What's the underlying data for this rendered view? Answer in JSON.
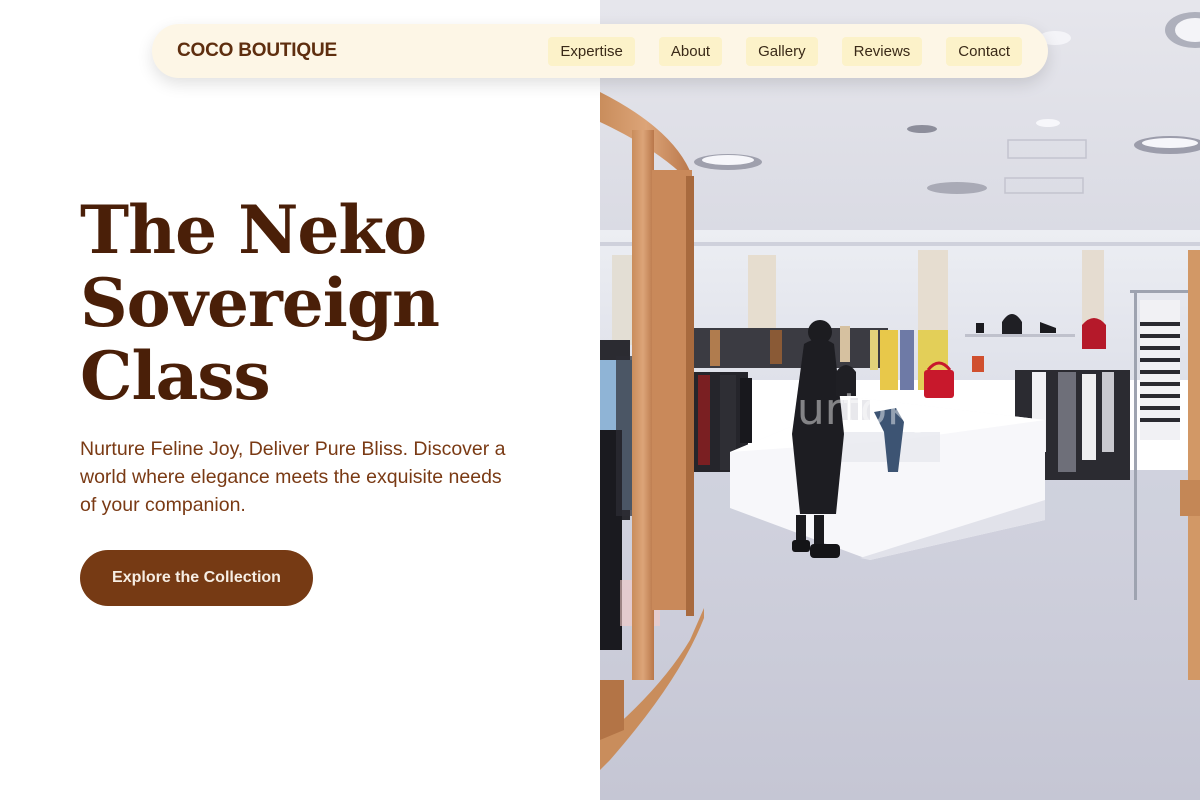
{
  "nav": {
    "brand": "COCO BOUTIQUE",
    "links": [
      "Expertise",
      "About",
      "Gallery",
      "Reviews",
      "Contact"
    ]
  },
  "hero": {
    "title_lines": [
      "The Neko",
      "Sovereign",
      "Class"
    ],
    "subtitle": "Nurture Feline Joy, Deliver Pure Bliss. Discover a world where elegance meets the exquisite needs of your companion.",
    "cta_label": "Explore the Collection"
  },
  "photo": {
    "watermark": "ourtokyo",
    "description": ""
  },
  "colors": {
    "brand": "#5e2e0f",
    "title": "#4a1f08",
    "subtitle": "#7a3a14",
    "cta_bg": "#763a14",
    "nav_bg": "#fdf6e6",
    "nav_link_bg": "#fcf2c9"
  }
}
